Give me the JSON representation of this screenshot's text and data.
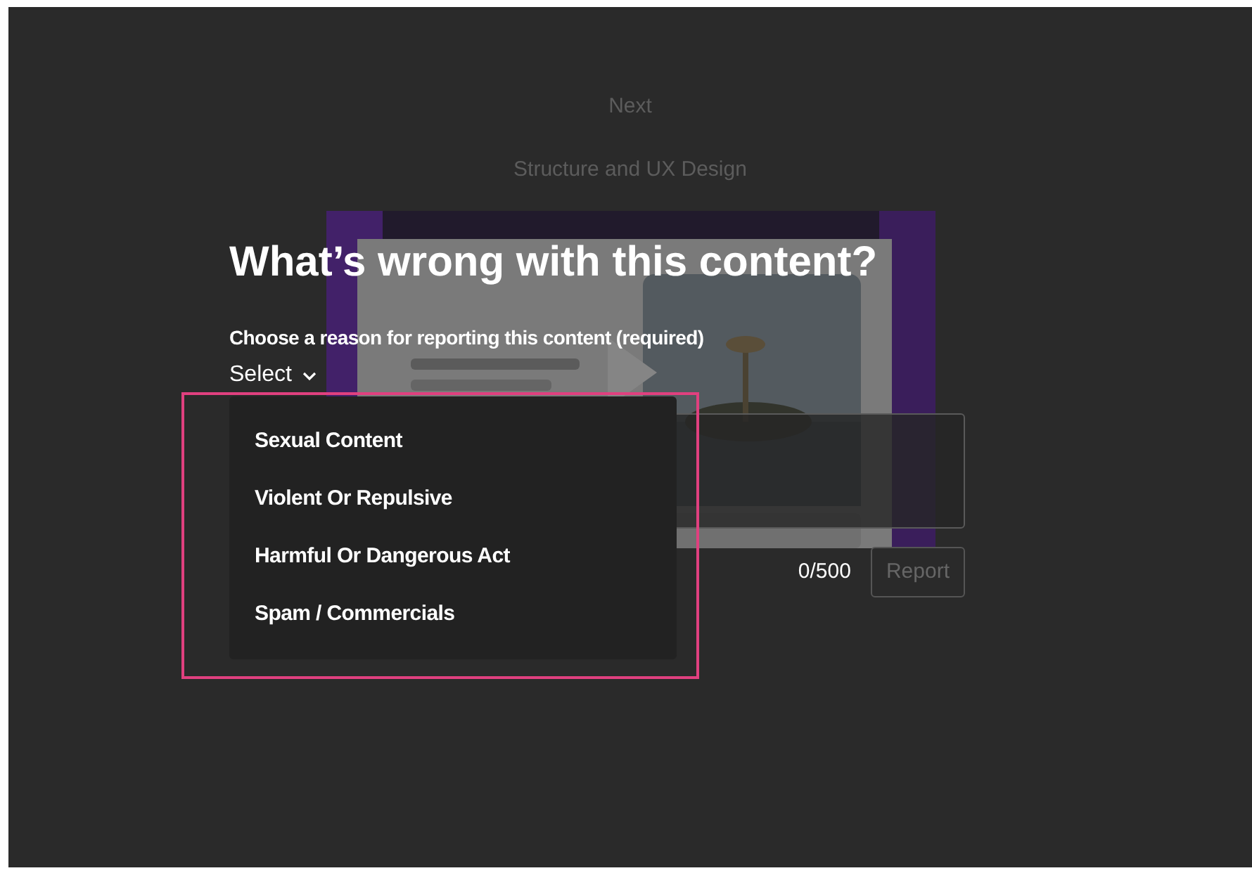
{
  "background": {
    "links": [
      "Next",
      "Structure and UX Design"
    ]
  },
  "dialog": {
    "title": "What’s wrong with this content?",
    "reason_label": "Choose a reason for reporting this content (required)",
    "select": {
      "value": "Select",
      "expanded": true,
      "options": [
        "Sexual Content",
        "Violent Or Repulsive",
        "Harmful Or Dangerous Act",
        "Spam / Commercials"
      ]
    },
    "counter": "0/500",
    "submit": {
      "label": "Report",
      "disabled": true
    }
  }
}
